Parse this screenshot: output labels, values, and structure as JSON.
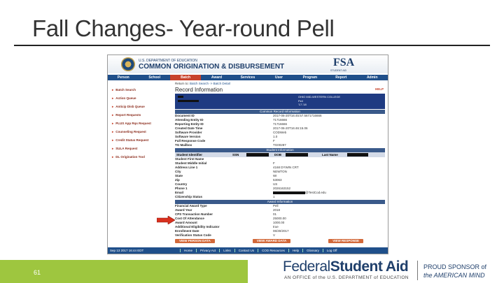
{
  "slide": {
    "title": "Fall Changes- Year-round Pell",
    "number": "61",
    "brand_part1": "Federal",
    "brand_part2": "Student Aid",
    "brand_tagline": "AN OFFICE of the U.S. DEPARTMENT of EDUCATION",
    "sponsor_line1": "PROUD SPONSOR of",
    "sponsor_line2": "the AMERICAN MIND",
    "colors": {
      "accent_green": "#9ec63f",
      "navy": "#1f3f6b",
      "nav_blue": "#1f4f8a",
      "active_red": "#c8432c"
    }
  },
  "app": {
    "dept": "U.S. DEPARTMENT OF EDUCATION",
    "title": "COMMON ORIGINATION & DISBURSEMENT",
    "logo": "FSA",
    "logo_sub": "STUDENT AID",
    "nav": [
      "Person",
      "School",
      "Batch",
      "Award",
      "Services",
      "User",
      "Program",
      "Report",
      "Admin"
    ],
    "active_nav": "Batch",
    "sidebar": [
      "Batch Search",
      "Action Queue",
      "Anticip Disb Queue",
      "Report Requests",
      "PLUS App Rqs Request",
      "Counseling Request",
      "Credit Status Request",
      "SULA Request",
      "DL Origination Tool"
    ],
    "return_prefix": "Return to:",
    "return_link": "Batch Search -> Batch Detail",
    "page_heading": "Record Information",
    "help": "HELP",
    "banner_right": [
      "OHIO MID-WESTERN COLLEGE",
      "Pell",
      "'17-'18"
    ],
    "sections": {
      "common": "Common Record Information",
      "student": "Student Information",
      "award": "Award Information"
    },
    "common_rows": [
      {
        "label": "Document ID",
        "value": "2017-06-20T16:45:57.5671716666"
      },
      {
        "label": "Attending Entity ID",
        "value": "71716666"
      },
      {
        "label": "Reporting Entity ID",
        "value": "71716666"
      },
      {
        "label": "Created Date Time",
        "value": "2017-06-20T16:46:15.06"
      },
      {
        "label": "Software Provider",
        "value": "CODWeb"
      },
      {
        "label": "Software Version",
        "value": "1.0"
      },
      {
        "label": "Full Response Code",
        "value": "F"
      },
      {
        "label": "TG Mailbox",
        "value": "TG00287"
      }
    ],
    "student_header": {
      "c1": "Student Identifier",
      "c2": "SSN",
      "c3": "DOB",
      "c4": "Last Name"
    },
    "student_rows": [
      {
        "label": "Student First Name",
        "value": ""
      },
      {
        "label": "Student Middle Initial",
        "value": "F"
      },
      {
        "label": "Address Line 1",
        "value": "4168 DYWIN CRT"
      },
      {
        "label": "City",
        "value": "NEWTON"
      },
      {
        "label": "State",
        "value": "WI"
      },
      {
        "label": "Zip",
        "value": "53063"
      },
      {
        "label": "Country",
        "value": "US"
      },
      {
        "label": "Phone 1",
        "value": "2026163152"
      },
      {
        "label": "Email",
        "value": "@TestCod.edu"
      },
      {
        "label": "Citizenship Status",
        "value": "1"
      }
    ],
    "award_rows": [
      {
        "label": "Financial Award Type",
        "value": "Pell"
      },
      {
        "label": "Award Year",
        "value": "2018"
      },
      {
        "label": "CPS Transaction Number",
        "value": "01"
      },
      {
        "label": "Cost Of Attendance",
        "value": "25000.00"
      },
      {
        "label": "Award Amount",
        "value": "1000.00"
      },
      {
        "label": "Additional Eligibility Indicator",
        "value": "true"
      },
      {
        "label": "Enrollment Date",
        "value": "06/30/2017"
      },
      {
        "label": "Verification Status Code",
        "value": "V"
      }
    ],
    "buttons": [
      "VIEW PERSON DATA",
      "VIEW AWARD DATA",
      "VIEW RESPONSE"
    ],
    "footer_time": "Sep 13 2017 16:44 EDT",
    "footer_links": [
      "Home",
      "Privacy Act",
      "Links",
      "Contact Us",
      "COD Resources",
      "Help",
      "Glossary",
      "Log Off"
    ]
  }
}
